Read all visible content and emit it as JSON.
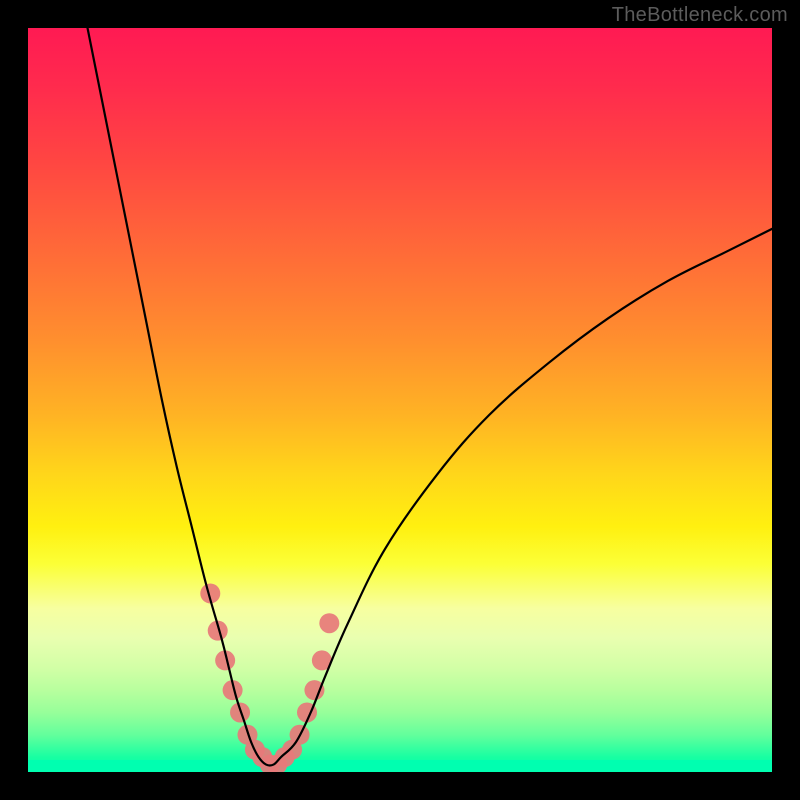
{
  "watermark": "TheBottleneck.com",
  "chart_data": {
    "type": "line",
    "title": "",
    "xlabel": "",
    "ylabel": "",
    "xlim": [
      0,
      100
    ],
    "ylim": [
      0,
      100
    ],
    "grid": false,
    "series": [
      {
        "name": "bottleneck-curve",
        "x": [
          8,
          10,
          12,
          14,
          16,
          18,
          20,
          22,
          24,
          26,
          27,
          28,
          29,
          30,
          31,
          32,
          33,
          34,
          36,
          38,
          40,
          43,
          48,
          55,
          62,
          70,
          78,
          86,
          94,
          100
        ],
        "y": [
          100,
          90,
          80,
          70,
          60,
          50,
          41,
          33,
          25,
          18,
          14,
          10,
          7,
          4,
          2,
          1,
          1,
          2,
          4,
          8,
          13,
          20,
          30,
          40,
          48,
          55,
          61,
          66,
          70,
          73
        ]
      }
    ],
    "markers": {
      "name": "highlighted-points",
      "color": "#e77a7a",
      "x": [
        24.5,
        25.5,
        26.5,
        27.5,
        28.5,
        29.5,
        30.5,
        31.5,
        32.5,
        33.5,
        34.5,
        35.5,
        36.5,
        37.5,
        38.5,
        39.5,
        40.5
      ],
      "y": [
        24,
        19,
        15,
        11,
        8,
        5,
        3,
        2,
        1,
        1,
        2,
        3,
        5,
        8,
        11,
        15,
        20
      ]
    }
  }
}
